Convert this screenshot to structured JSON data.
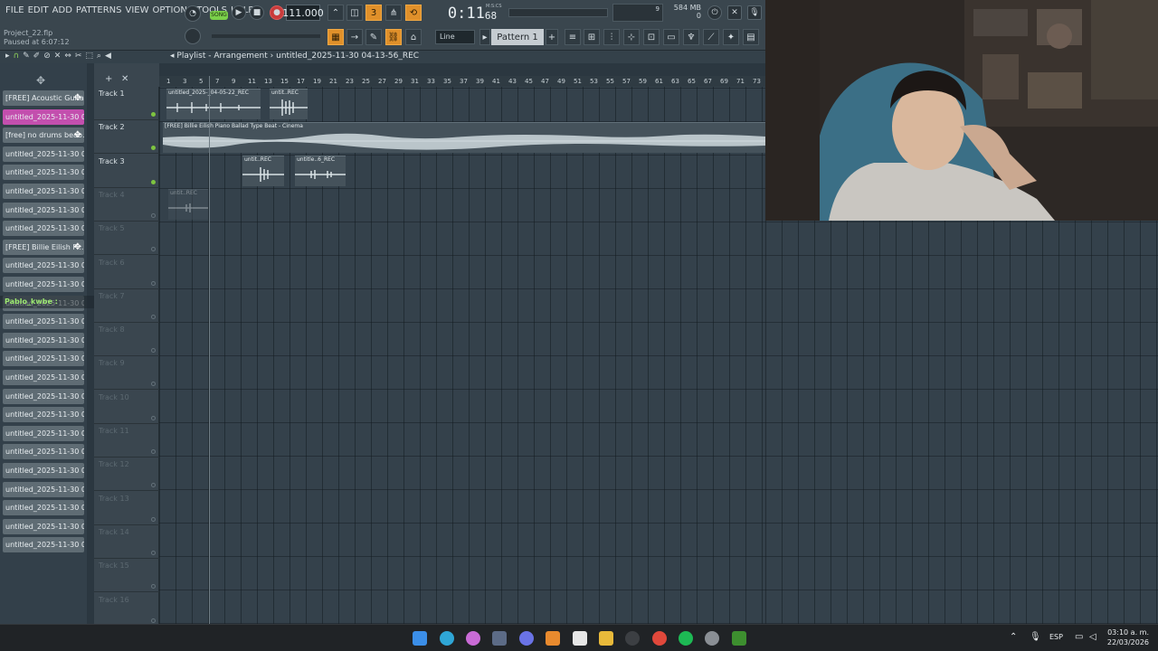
{
  "menu": [
    "FILE",
    "EDIT",
    "ADD",
    "PATTERNS",
    "VIEW",
    "OPTIONS",
    "TOOLS",
    "HELP"
  ],
  "hint": {
    "project": "Project_22.flp",
    "status": "Paused at 6:07:12"
  },
  "transport": {
    "song_label": "SONG",
    "tempo": "111.000",
    "time": "0:11",
    "time_small": "68",
    "mcs": "M:S:CS"
  },
  "memory": {
    "cpu": "9",
    "mem": "584 MB",
    "voices": "0"
  },
  "snap": "Line",
  "pattern": "Pattern 1",
  "breadcrumb": "Playlist - Arrangement",
  "breadcrumb_file": "untitled_2025-11-30 04-13-56_REC",
  "browser_items": [
    "[FREE] Acoustic Guita...",
    "untitled_2025-11-30 03-...",
    "[free] no drums beab...",
    "untitled_2025-11-30 03-...",
    "untitled_2025-11-30 03-...",
    "untitled_2025-11-30 03-...",
    "untitled_2025-11-30 03-...",
    "untitled_2025-11-30 03-...",
    "[FREE] Billie Eilish Pi...",
    "untitled_2025-11-30 04-...",
    "untitled_2025-11-30 04-...",
    "untitled_2025-11-30 04-...",
    "untitled_2025-11-30 04-...",
    "untitled_2025-11-30 04-...",
    "untitled_2025-11-30 04-...",
    "untitled_2025-11-30 04-...",
    "untitled_2025-11-30 04-...",
    "untitled_2025-11-30 04-...",
    "untitled_2025-11-30 04-...",
    "untitled_2025-11-30 04-...",
    "untitled_2025-11-30 04-...",
    "untitled_2025-11-30 04-...",
    "untitled_2025-11-30 04-...",
    "untitled_2025-11-30 04-...",
    "untitled_2025-11-30 04-..."
  ],
  "overlay_name": "Pablo_kwbe :",
  "tracks": [
    "Track 1",
    "Track 2",
    "Track 3",
    "Track 4",
    "Track 5",
    "Track 6",
    "Track 7",
    "Track 8",
    "Track 9",
    "Track 10",
    "Track 11",
    "Track 12",
    "Track 13",
    "Track 14",
    "Track 15",
    "Track 16"
  ],
  "ruler": [
    "1",
    "3",
    "5",
    "7",
    "9",
    "11",
    "13",
    "15",
    "17",
    "19",
    "21",
    "23",
    "25",
    "27",
    "29",
    "31",
    "33",
    "35",
    "37",
    "39",
    "41",
    "43",
    "45",
    "47",
    "49",
    "51",
    "53",
    "55",
    "57",
    "59",
    "61",
    "63",
    "65",
    "67",
    "69",
    "71",
    "73"
  ],
  "clips": {
    "c1": "untitled_2025-_04-05-22_REC",
    "c2": "untit..REC",
    "c3": "[FREE] Billie Eilish Piano Ballad Type Beat - Cinema",
    "c4": "untit..REC",
    "c5": "untitle..6_REC",
    "c6": "untit..REC"
  },
  "taskbar": {
    "lang": "ESP",
    "time": "03:10 a. m.",
    "date": "22/03/2026"
  },
  "colors": {
    "accent_orange": "#e0902a",
    "selected_clip": "#c34fae",
    "led_green": "#7ec440"
  }
}
